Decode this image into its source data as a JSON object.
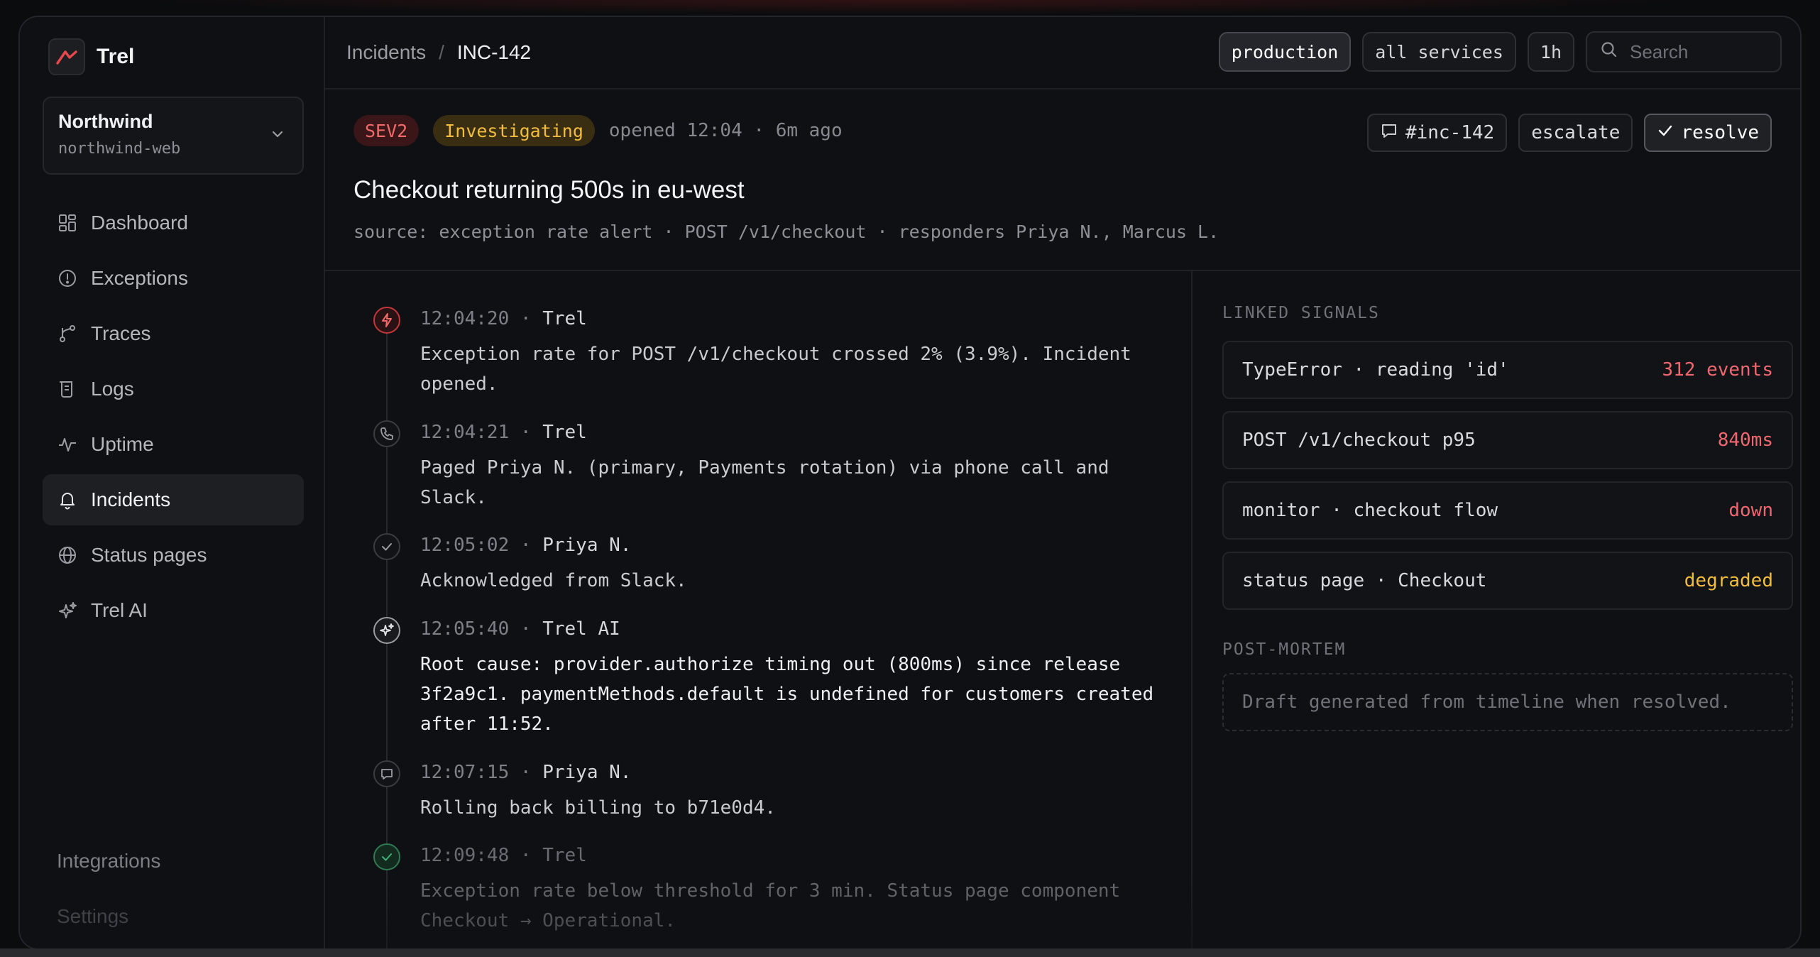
{
  "app": {
    "name": "Trel"
  },
  "workspace": {
    "name": "Northwind",
    "project": "northwind-web"
  },
  "nav": [
    {
      "label": "Dashboard",
      "icon": "dashboard-icon"
    },
    {
      "label": "Exceptions",
      "icon": "exceptions-icon"
    },
    {
      "label": "Traces",
      "icon": "traces-icon"
    },
    {
      "label": "Logs",
      "icon": "logs-icon"
    },
    {
      "label": "Uptime",
      "icon": "uptime-icon"
    },
    {
      "label": "Incidents",
      "icon": "bell-icon",
      "active": true
    },
    {
      "label": "Status pages",
      "icon": "globe-icon"
    },
    {
      "label": "Trel AI",
      "icon": "sparkle-icon"
    }
  ],
  "footer_nav": [
    {
      "label": "Integrations"
    },
    {
      "label": "Settings"
    }
  ],
  "breadcrumb": {
    "parent": "Incidents",
    "separator": "/",
    "current": "INC-142"
  },
  "filters": {
    "environment": "production",
    "services": "all services",
    "range": "1h",
    "search_placeholder": "Search"
  },
  "incident": {
    "severity": "SEV2",
    "status": "Investigating",
    "opened": "opened 12:04 · 6m ago",
    "title": "Checkout returning 500s in eu-west",
    "source": "source: exception rate alert · POST /v1/checkout · responders Priya N., Marcus L.",
    "actions": {
      "channel": "#inc-142",
      "escalate": "escalate",
      "resolve": "resolve"
    }
  },
  "timeline": [
    {
      "time": "12:04:20",
      "sep": "·",
      "who": "Trel",
      "text": "Exception rate for POST /v1/checkout crossed 2% (3.9%). Incident opened.",
      "icon": "alert-icon"
    },
    {
      "time": "12:04:21",
      "sep": "·",
      "who": "Trel",
      "text": "Paged Priya N. (primary, Payments rotation) via phone call and Slack.",
      "icon": "phone-icon"
    },
    {
      "time": "12:05:02",
      "sep": "·",
      "who": "Priya N.",
      "text": "Acknowledged from Slack.",
      "icon": "check-icon"
    },
    {
      "time": "12:05:40",
      "sep": "·",
      "who": "Trel AI",
      "text": "Root cause: provider.authorize timing out (800ms) since release 3f2a9c1. paymentMethods.default is undefined for customers created after 11:52.",
      "icon": "ai-sparkle-icon"
    },
    {
      "time": "12:07:15",
      "sep": "·",
      "who": "Priya N.",
      "text": "Rolling back billing to b71e0d4.",
      "icon": "comment-icon"
    },
    {
      "time": "12:09:48",
      "sep": "·",
      "who": "Trel",
      "text": "Exception rate below threshold for 3 min. Status page component Checkout → Operational.",
      "icon": "check-circle-icon"
    }
  ],
  "linked_signals": {
    "label": "LINKED SIGNALS",
    "items": [
      {
        "label": "TypeError · reading 'id'",
        "value": "312 events",
        "color": "#f0686f"
      },
      {
        "label": "POST /v1/checkout p95",
        "value": "840ms",
        "color": "#f0686f"
      },
      {
        "label": "monitor · checkout flow",
        "value": "down",
        "color": "#f0686f"
      },
      {
        "label": "status page · Checkout",
        "value": "degraded",
        "color": "#f2bd3d"
      }
    ]
  },
  "postmortem": {
    "label": "POST-MORTEM",
    "placeholder": "Draft generated from timeline when resolved."
  },
  "colors": {
    "accent_red": "#e5484d",
    "sev_bg": "#3a1618",
    "warning": "#f2bd3d",
    "success": "#30a46c"
  }
}
